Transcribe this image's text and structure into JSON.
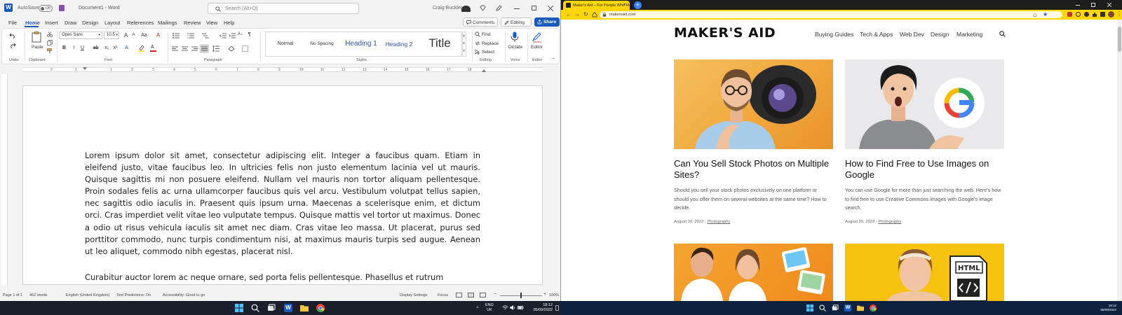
{
  "word": {
    "title_bar": {
      "autosave_label": "AutoSave",
      "toggle_state": "Off",
      "document_name": "Document1 - Word",
      "search_placeholder": "Search (Alt+Q)",
      "user_name": "Craig Buckler"
    },
    "menu": [
      "File",
      "Home",
      "Insert",
      "Draw",
      "Design",
      "Layout",
      "References",
      "Mailings",
      "Review",
      "View",
      "Help"
    ],
    "active_menu": "Home",
    "comments_label": "Comments",
    "editing_label": "Editing",
    "share_label": "Share",
    "ribbon": {
      "paste_label": "Paste",
      "font_name": "Open Sans",
      "font_size": "10.5",
      "styles": [
        "Normal",
        "No Spacing",
        "Heading 1",
        "Heading 2",
        "Title"
      ],
      "find_label": "Find",
      "replace_label": "Replace",
      "select_label": "Select",
      "dictate_label": "Dictate",
      "editor_label": "Editor",
      "groups": [
        "Undo",
        "Clipboard",
        "Font",
        "Paragraph",
        "Styles",
        "Editing",
        "Voice",
        "Editor"
      ]
    },
    "ruler_ticks": [
      "2",
      "1",
      "1",
      "2",
      "3",
      "4",
      "5",
      "6",
      "7",
      "8",
      "9",
      "10",
      "11",
      "12",
      "13",
      "14",
      "15",
      "16",
      "17",
      "18"
    ],
    "document": {
      "paragraph_1": "Lorem ipsum dolor sit amet, consectetur adipiscing elit. Integer a faucibus quam. Etiam in eleifend justo, vitae faucibus leo. In ultricies felis non justo elementum lacinia vel ut mauris. Quisque sagittis mi non posuere eleifend. Nullam vel mauris non tortor aliquam pellentesque. Proin sodales felis ac urna ullamcorper faucibus quis vel arcu. Vestibulum volutpat tellus sapien, nec sagittis odio iaculis in. Praesent quis ipsum urna. Maecenas a scelerisque enim, et dictum orci. Cras imperdiet velit vitae leo vulputate tempus. Quisque mattis vel tortor ut maximus. Donec a odio ut risus vehicula iaculis sit amet nec diam. Cras vitae leo massa. Ut placerat, purus sed porttitor commodo, nunc turpis condimentum nisi, at maximus mauris turpis sed augue. Aenean ut leo aliquet, commodo nibh egestas, placerat nisl.",
      "paragraph_2": "Curabitur auctor lorem ac neque ornare, sed porta felis pellentesque. Phasellus et rutrum"
    },
    "status_bar": {
      "page": "Page 1 of 1",
      "words": "462 words",
      "language": "English (United Kingdom)",
      "text_predictions": "Text Predictions: On",
      "accessibility": "Accessibility: Good to go",
      "display_settings": "Display Settings",
      "focus": "Focus",
      "zoom": "100%"
    }
  },
  "browser": {
    "tab_title": "Maker's Aid – For People Who M...",
    "url": "makersaid.com",
    "site": {
      "logo": "MAKER'S AID",
      "nav": [
        "Buying Guides",
        "Tech & Apps",
        "Web Dev",
        "Design",
        "Marketing"
      ],
      "articles": [
        {
          "title": "Can You Sell Stock Photos on Multiple Sites?",
          "excerpt": "Should you sell your stock photos exclusively on one platform or should you offer them on several websites at the same time? How to decide.",
          "date": "August 30, 2022",
          "category": "Photography"
        },
        {
          "title": "How to Find Free to Use Images on Google",
          "excerpt": "You can use Google for more than just searching the web. Here's how to find free to use Creative Commons images with Google's image search.",
          "date": "August 30, 2022",
          "category": "Photography"
        }
      ],
      "html_badge": "HTML"
    }
  },
  "taskbar_left": {
    "language": "ENG",
    "region": "UK",
    "time": "18:12",
    "date": "05/09/2022"
  },
  "taskbar_right": {
    "time": "18:12",
    "date": "05/09/2022"
  }
}
